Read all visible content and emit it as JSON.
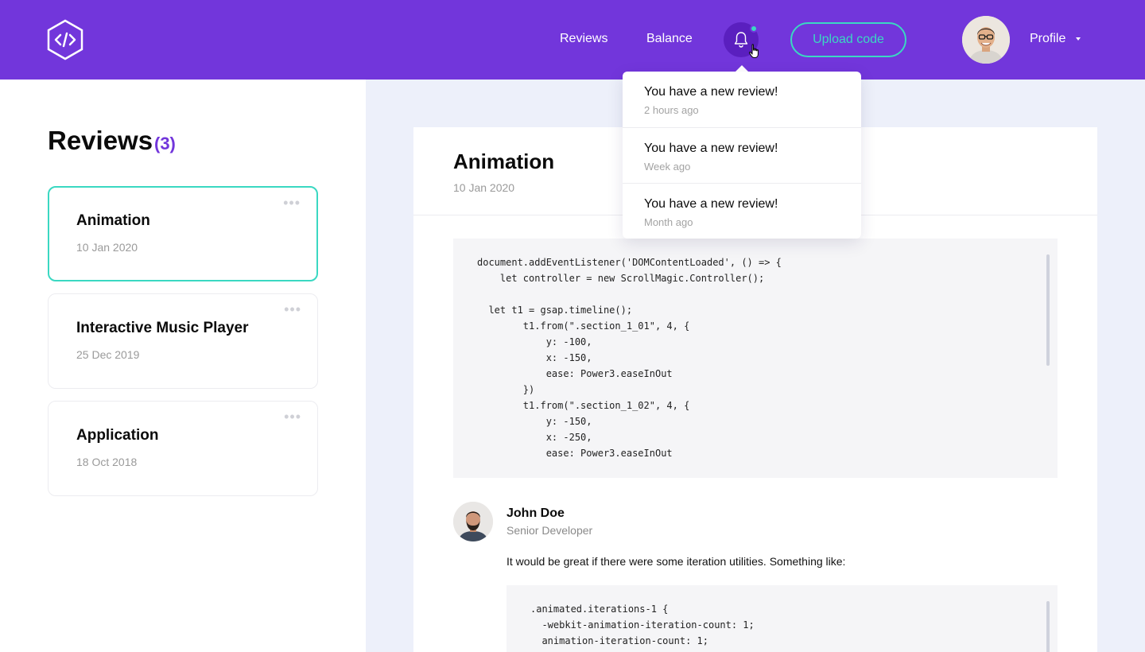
{
  "colors": {
    "brand": "#7236db",
    "accent": "#3ad8c2",
    "panel_bg": "#edf0fa"
  },
  "header": {
    "nav": {
      "reviews": "Reviews",
      "balance": "Balance"
    },
    "upload_label": "Upload code",
    "profile_label": "Profile",
    "has_new_notification": true
  },
  "sidebar": {
    "title": "Reviews",
    "count": "(3)",
    "cards": [
      {
        "title": "Animation",
        "date": "10 Jan 2020",
        "selected": true
      },
      {
        "title": "Interactive Music Player",
        "date": "25 Dec 2019",
        "selected": false
      },
      {
        "title": "Application",
        "date": "18 Oct 2018",
        "selected": false
      }
    ]
  },
  "detail": {
    "title": "Animation",
    "date": "10 Jan 2020",
    "code": "document.addEventListener('DOMContentLoaded', () => {\n    let controller = new ScrollMagic.Controller();\n\n  let t1 = gsap.timeline();\n        t1.from(\".section_1_01\", 4, {\n            y: -100,\n            x: -150,\n            ease: Power3.easeInOut\n        })\n        t1.from(\".section_1_02\", 4, {\n            y: -150,\n            x: -250,\n            ease: Power3.easeInOut",
    "comment": {
      "author": "John Doe",
      "role": "Senior Developer",
      "text": "It would be great if there were some iteration utilities. Something like:",
      "code": ".animated.iterations-1 {\n  -webkit-animation-iteration-count: 1;\n  animation-iteration-count: 1;"
    }
  },
  "notifications": [
    {
      "title": "You have a new review!",
      "time": "2 hours ago"
    },
    {
      "title": "You have a new review!",
      "time": "Week ago"
    },
    {
      "title": "You have a new review!",
      "time": "Month ago"
    }
  ]
}
